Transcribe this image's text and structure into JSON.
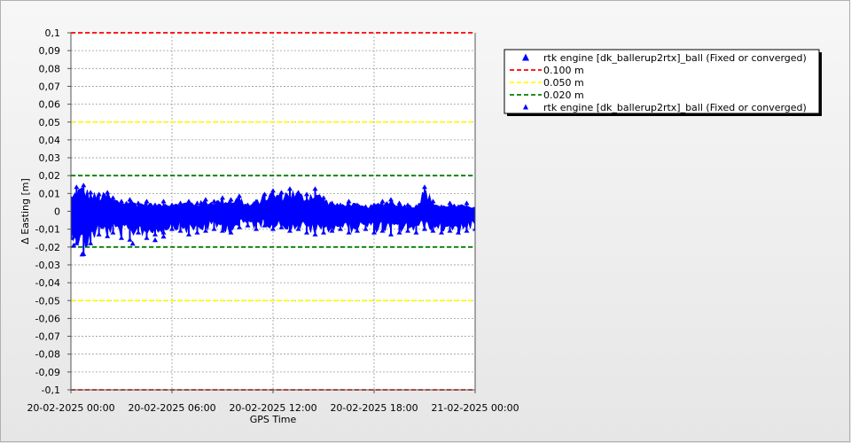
{
  "chart_data": {
    "type": "scatter",
    "title": "",
    "xlabel": "GPS Time",
    "ylabel": "Δ Easting [m]",
    "ylim": [
      -0.1,
      0.1
    ],
    "xlim": [
      "20-02-2025 00:00",
      "21-02-2025 00:00"
    ],
    "x_ticks": [
      "20-02-2025 00:00",
      "20-02-2025 06:00",
      "20-02-2025 12:00",
      "20-02-2025 18:00",
      "21-02-2025 00:00"
    ],
    "y_ticks": [
      "0,1",
      "0,09",
      "0,08",
      "0,07",
      "0,06",
      "0,05",
      "0,04",
      "0,03",
      "0,02",
      "0,01",
      "0",
      "-0,01",
      "-0,02",
      "-0,03",
      "-0,04",
      "-0,05",
      "-0,06",
      "-0,07",
      "-0,08",
      "-0,09",
      "-0,1"
    ],
    "grid": true,
    "legend_position": "right",
    "legend": [
      {
        "name": "rtk engine [dk_ballerup2rtx]_ball (Fixed or converged)",
        "kind": "marker",
        "color": "#0000ff"
      },
      {
        "name": "0.100 m",
        "kind": "dashed-line",
        "color": "#ff0000"
      },
      {
        "name": "0.050 m",
        "kind": "dashed-line",
        "color": "#ffff00"
      },
      {
        "name": "0.020 m",
        "kind": "dashed-line",
        "color": "#008000"
      },
      {
        "name": "rtk engine [dk_ballerup2rtx]_ball (Fixed or converged)",
        "kind": "marker-small",
        "color": "#0000ff"
      }
    ],
    "threshold_lines": [
      {
        "value": 0.1,
        "color": "#ff0000"
      },
      {
        "value": -0.1,
        "color": "#ff0000"
      },
      {
        "value": 0.05,
        "color": "#ffff00"
      },
      {
        "value": -0.05,
        "color": "#ffff00"
      },
      {
        "value": 0.02,
        "color": "#008000"
      },
      {
        "value": -0.02,
        "color": "#008000"
      }
    ],
    "series": [
      {
        "name": "rtk engine [dk_ballerup2rtx]_ball (Fixed or converged)",
        "color": "#0000ff",
        "envelope": {
          "x": [
            "20-02-2025 00:00",
            "20-02-2025 00:20",
            "20-02-2025 00:45",
            "20-02-2025 01:10",
            "20-02-2025 01:40",
            "20-02-2025 02:10",
            "20-02-2025 02:30",
            "20-02-2025 03:00",
            "20-02-2025 03:30",
            "20-02-2025 04:00",
            "20-02-2025 04:30",
            "20-02-2025 05:00",
            "20-02-2025 05:30",
            "20-02-2025 06:00",
            "20-02-2025 06:30",
            "20-02-2025 07:00",
            "20-02-2025 07:30",
            "20-02-2025 08:00",
            "20-02-2025 08:30",
            "20-02-2025 09:00",
            "20-02-2025 09:30",
            "20-02-2025 10:00",
            "20-02-2025 10:30",
            "20-02-2025 11:00",
            "20-02-2025 11:30",
            "20-02-2025 12:00",
            "20-02-2025 12:30",
            "20-02-2025 13:00",
            "20-02-2025 13:30",
            "20-02-2025 14:00",
            "20-02-2025 14:30",
            "20-02-2025 15:00",
            "20-02-2025 15:30",
            "20-02-2025 16:00",
            "20-02-2025 16:30",
            "20-02-2025 17:00",
            "20-02-2025 17:30",
            "20-02-2025 18:00",
            "20-02-2025 18:30",
            "20-02-2025 19:00",
            "20-02-2025 19:30",
            "20-02-2025 20:00",
            "20-02-2025 20:30",
            "20-02-2025 21:00",
            "20-02-2025 21:30",
            "20-02-2025 22:00",
            "20-02-2025 22:30",
            "20-02-2025 23:00",
            "20-02-2025 23:30",
            "21-02-2025 00:00"
          ],
          "upper": [
            0.008,
            0.014,
            0.015,
            0.011,
            0.01,
            0.011,
            0.008,
            0.006,
            0.007,
            0.005,
            0.006,
            0.004,
            0.006,
            0.004,
            0.005,
            0.006,
            0.005,
            0.007,
            0.006,
            0.008,
            0.007,
            0.009,
            0.004,
            0.006,
            0.01,
            0.012,
            0.011,
            0.013,
            0.011,
            0.01,
            0.013,
            0.008,
            0.005,
            0.004,
            0.006,
            0.004,
            0.003,
            0.004,
            0.006,
            0.007,
            0.005,
            0.004,
            0.003,
            0.014,
            0.006,
            0.003,
            0.005,
            0.003,
            0.005,
            0.002
          ],
          "lower": [
            -0.015,
            -0.018,
            -0.024,
            -0.018,
            -0.013,
            -0.014,
            -0.012,
            -0.015,
            -0.016,
            -0.012,
            -0.015,
            -0.013,
            -0.012,
            -0.01,
            -0.011,
            -0.013,
            -0.012,
            -0.011,
            -0.01,
            -0.011,
            -0.012,
            -0.009,
            -0.008,
            -0.01,
            -0.008,
            -0.01,
            -0.009,
            -0.011,
            -0.01,
            -0.012,
            -0.013,
            -0.012,
            -0.011,
            -0.01,
            -0.012,
            -0.011,
            -0.01,
            -0.012,
            -0.011,
            -0.013,
            -0.012,
            -0.011,
            -0.012,
            -0.01,
            -0.011,
            -0.012,
            -0.011,
            -0.012,
            -0.011,
            -0.01
          ]
        },
        "outliers": [
          {
            "x": "20-02-2025 00:10",
            "y": -0.019
          },
          {
            "x": "20-02-2025 00:40",
            "y": -0.024
          },
          {
            "x": "20-02-2025 03:40",
            "y": -0.018
          },
          {
            "x": "20-02-2025 05:00",
            "y": -0.016
          },
          {
            "x": "20-02-2025 05:30",
            "y": -0.014
          }
        ]
      }
    ]
  }
}
